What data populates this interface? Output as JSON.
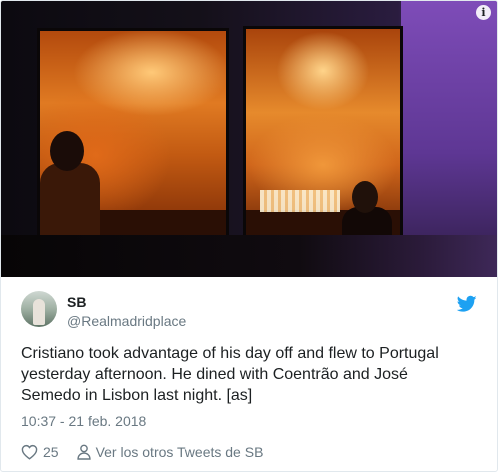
{
  "tweet": {
    "display_name": "SB",
    "handle": "@Realmadridplace",
    "text": "Cristiano took advantage of his day off and flew to Portugal yesterday afternoon. He dined with Coentrão and José Semedo in Lisbon last night. [as]",
    "timestamp": "10:37 - 21 feb. 2018",
    "likes": "25",
    "profile_link": "Ver los otros Tweets de SB"
  },
  "photo": {
    "info_glyph": "i"
  },
  "icons": {
    "info": "info-icon",
    "avatar": "avatar",
    "brand": "twitter-bird-icon",
    "like": "heart-icon",
    "profile": "person-icon"
  },
  "colors": {
    "brand": "#1da1f2",
    "text": "#1c2022",
    "muted": "#697882",
    "border": "#e1e8ed"
  }
}
